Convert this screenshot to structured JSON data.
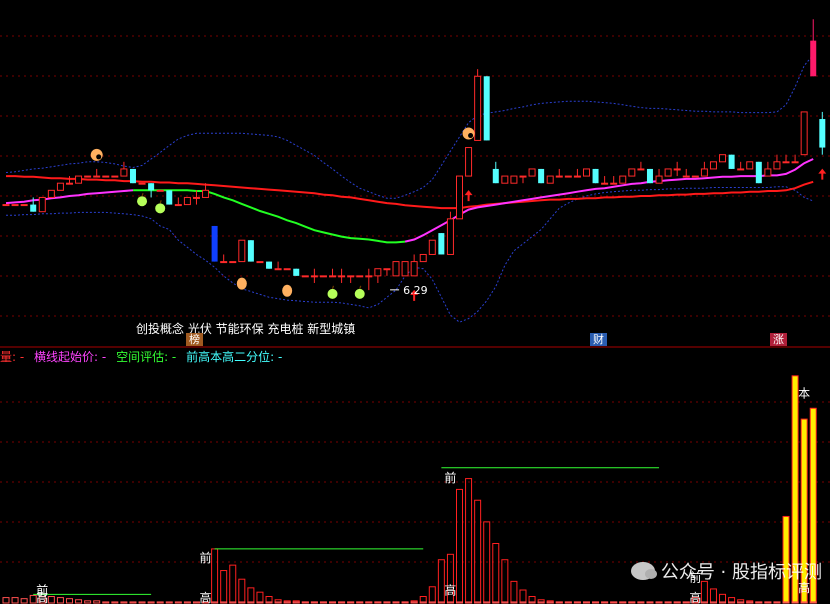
{
  "chart_data": [
    {
      "type": "candlestick",
      "candles": [
        [
          6.6,
          6.6,
          6.6,
          6.6
        ],
        [
          6.6,
          6.6,
          6.6,
          6.6
        ],
        [
          6.6,
          6.6,
          6.6,
          6.6
        ],
        [
          6.6,
          6.5,
          6.7,
          6.5
        ],
        [
          6.5,
          6.7,
          6.7,
          6.5
        ],
        [
          6.7,
          6.8,
          6.8,
          6.7
        ],
        [
          6.8,
          6.9,
          6.9,
          6.8
        ],
        [
          6.9,
          6.9,
          7.0,
          6.9
        ],
        [
          6.9,
          7.0,
          7.0,
          6.9
        ],
        [
          7.0,
          7.0,
          7.0,
          7.0
        ],
        [
          7.0,
          7.0,
          7.1,
          7.0
        ],
        [
          7.0,
          7.0,
          7.0,
          7.0
        ],
        [
          7.0,
          7.0,
          7.0,
          7.0
        ],
        [
          7.0,
          7.1,
          7.2,
          7.0
        ],
        [
          7.1,
          6.9,
          7.1,
          6.9
        ],
        [
          6.9,
          6.9,
          6.9,
          6.9
        ],
        [
          6.9,
          6.8,
          6.9,
          6.7
        ],
        [
          6.8,
          6.8,
          6.8,
          6.8
        ],
        [
          6.8,
          6.6,
          6.8,
          6.6
        ],
        [
          6.6,
          6.6,
          6.7,
          6.6
        ],
        [
          6.6,
          6.7,
          6.7,
          6.6
        ],
        [
          6.7,
          6.7,
          6.8,
          6.6
        ],
        [
          6.7,
          6.8,
          6.9,
          6.7
        ],
        [
          6.3,
          5.8,
          6.3,
          5.8
        ],
        [
          5.8,
          5.8,
          5.9,
          5.8
        ],
        [
          5.8,
          5.8,
          5.8,
          5.8
        ],
        [
          5.8,
          6.1,
          6.1,
          5.8
        ],
        [
          6.1,
          5.8,
          6.1,
          5.8
        ],
        [
          5.8,
          5.8,
          5.8,
          5.8
        ],
        [
          5.8,
          5.7,
          5.8,
          5.7
        ],
        [
          5.7,
          5.7,
          5.8,
          5.7
        ],
        [
          5.7,
          5.7,
          5.7,
          5.7
        ],
        [
          5.7,
          5.6,
          5.7,
          5.6
        ],
        [
          5.6,
          5.6,
          5.6,
          5.6
        ],
        [
          5.6,
          5.6,
          5.7,
          5.5
        ],
        [
          5.6,
          5.6,
          5.6,
          5.6
        ],
        [
          5.6,
          5.6,
          5.7,
          5.6
        ],
        [
          5.6,
          5.6,
          5.7,
          5.5
        ],
        [
          5.6,
          5.6,
          5.6,
          5.5
        ],
        [
          5.6,
          5.6,
          5.6,
          5.6
        ],
        [
          5.6,
          5.6,
          5.7,
          5.4
        ],
        [
          5.6,
          5.7,
          5.7,
          5.5
        ],
        [
          5.7,
          5.7,
          5.7,
          5.6
        ],
        [
          5.6,
          5.8,
          5.8,
          5.6
        ],
        [
          5.6,
          5.8,
          5.8,
          5.6
        ],
        [
          5.6,
          5.8,
          5.9,
          5.6
        ],
        [
          5.8,
          5.9,
          5.9,
          5.8
        ],
        [
          5.9,
          6.1,
          6.1,
          5.9
        ],
        [
          6.2,
          5.9,
          6.2,
          5.9
        ],
        [
          5.9,
          6.4,
          6.5,
          5.9
        ],
        [
          6.4,
          7.0,
          7.0,
          6.4
        ],
        [
          7.0,
          7.4,
          7.4,
          7.0
        ],
        [
          7.5,
          8.4,
          8.5,
          7.5
        ],
        [
          8.4,
          7.5,
          8.4,
          7.5
        ],
        [
          7.1,
          6.9,
          7.2,
          6.9
        ],
        [
          6.9,
          7.0,
          7.0,
          6.9
        ],
        [
          6.9,
          7.0,
          7.0,
          6.9
        ],
        [
          7.0,
          7.0,
          7.0,
          6.9
        ],
        [
          7.0,
          7.1,
          7.1,
          7.0
        ],
        [
          7.1,
          6.9,
          7.1,
          6.9
        ],
        [
          6.9,
          7.0,
          7.0,
          6.9
        ],
        [
          7.0,
          7.0,
          7.1,
          7.0
        ],
        [
          7.0,
          7.0,
          7.0,
          7.0
        ],
        [
          7.0,
          7.0,
          7.1,
          7.0
        ],
        [
          7.0,
          7.1,
          7.1,
          7.0
        ],
        [
          7.1,
          6.9,
          7.1,
          6.9
        ],
        [
          6.9,
          6.9,
          7.0,
          6.9
        ],
        [
          6.9,
          6.9,
          7.0,
          6.9
        ],
        [
          6.9,
          7.0,
          7.0,
          6.9
        ],
        [
          7.0,
          7.1,
          7.1,
          7.0
        ],
        [
          7.1,
          7.1,
          7.2,
          7.1
        ],
        [
          7.1,
          6.9,
          7.1,
          6.9
        ],
        [
          6.9,
          7.0,
          7.1,
          6.9
        ],
        [
          7.0,
          7.1,
          7.1,
          7.0
        ],
        [
          7.1,
          7.1,
          7.2,
          7.0
        ],
        [
          7.0,
          7.0,
          7.1,
          7.0
        ],
        [
          7.0,
          7.0,
          7.0,
          7.0
        ],
        [
          7.0,
          7.1,
          7.2,
          7.0
        ],
        [
          7.1,
          7.2,
          7.2,
          7.1
        ],
        [
          7.2,
          7.3,
          7.3,
          7.2
        ],
        [
          7.3,
          7.1,
          7.3,
          7.1
        ],
        [
          7.1,
          7.1,
          7.2,
          7.1
        ],
        [
          7.1,
          7.2,
          7.2,
          7.1
        ],
        [
          7.2,
          6.9,
          7.2,
          6.9
        ],
        [
          7.0,
          7.1,
          7.2,
          7.0
        ],
        [
          7.1,
          7.2,
          7.3,
          7.1
        ],
        [
          7.2,
          7.2,
          7.3,
          7.2
        ],
        [
          7.2,
          7.2,
          7.3,
          7.2
        ],
        [
          7.3,
          7.9,
          7.9,
          7.3
        ],
        [
          8.9,
          8.4,
          9.2,
          8.4
        ],
        [
          7.8,
          7.4,
          7.9,
          7.3
        ]
      ],
      "up_color": "#ff2a2a",
      "down_color": "#54ffff",
      "ma_long": [
        7.0,
        7.0,
        6.99,
        6.99,
        6.98,
        6.97,
        6.97,
        6.96,
        6.96,
        6.95,
        6.95,
        6.94,
        6.94,
        6.93,
        6.93,
        6.92,
        6.92,
        6.91,
        6.91,
        6.9,
        6.9,
        6.89,
        6.88,
        6.87,
        6.86,
        6.85,
        6.84,
        6.83,
        6.82,
        6.81,
        6.8,
        6.79,
        6.78,
        6.77,
        6.76,
        6.74,
        6.73,
        6.71,
        6.7,
        6.68,
        6.66,
        6.64,
        6.62,
        6.61,
        6.59,
        6.58,
        6.57,
        6.56,
        6.55,
        6.55,
        6.55,
        6.57,
        6.58,
        6.6,
        6.61,
        6.62,
        6.63,
        6.64,
        6.65,
        6.66,
        6.67,
        6.67,
        6.68,
        6.68,
        6.69,
        6.69,
        6.7,
        6.7,
        6.71,
        6.71,
        6.72,
        6.72,
        6.73,
        6.73,
        6.74,
        6.74,
        6.75,
        6.75,
        6.76,
        6.76,
        6.77,
        6.77,
        6.78,
        6.78,
        6.79,
        6.79,
        6.8,
        6.83,
        6.88,
        6.92
      ],
      "ma_mid": [
        6.62,
        6.63,
        6.64,
        6.66,
        6.67,
        6.69,
        6.7,
        6.72,
        6.73,
        6.75,
        6.76,
        6.77,
        6.78,
        6.79,
        6.8,
        6.8,
        6.8,
        6.8,
        6.8,
        6.8,
        6.8,
        6.79,
        6.79,
        6.75,
        6.7,
        6.66,
        6.61,
        6.56,
        6.51,
        6.47,
        6.43,
        6.38,
        6.34,
        6.29,
        6.24,
        6.21,
        6.18,
        6.15,
        6.13,
        6.12,
        6.11,
        6.09,
        6.07,
        6.07,
        6.08,
        6.11,
        6.17,
        6.24,
        6.31,
        6.38,
        6.46,
        6.53,
        6.56,
        6.58,
        6.6,
        6.62,
        6.64,
        6.66,
        6.68,
        6.7,
        6.72,
        6.74,
        6.76,
        6.78,
        6.8,
        6.82,
        6.83,
        6.85,
        6.87,
        6.89,
        6.9,
        6.92,
        6.93,
        6.94,
        6.95,
        6.96,
        6.96,
        6.97,
        6.98,
        6.99,
        6.99,
        7.0,
        7.0,
        7.0,
        7.01,
        7.01,
        7.03,
        7.09,
        7.18,
        7.24
      ],
      "green_segment": [
        14,
        44
      ],
      "band_upper": [
        7.05,
        7.06,
        7.08,
        7.1,
        7.11,
        7.13,
        7.15,
        7.17,
        7.18,
        7.2,
        7.2,
        7.19,
        7.17,
        7.14,
        7.12,
        7.15,
        7.24,
        7.33,
        7.43,
        7.52,
        7.57,
        7.6,
        7.6,
        7.6,
        7.6,
        7.6,
        7.6,
        7.59,
        7.58,
        7.57,
        7.55,
        7.5,
        7.43,
        7.36,
        7.29,
        7.19,
        7.1,
        7.0,
        6.91,
        6.83,
        6.78,
        6.73,
        6.69,
        6.69,
        6.73,
        6.78,
        6.84,
        6.95,
        7.15,
        7.35,
        7.55,
        7.75,
        7.85,
        7.88,
        7.9,
        7.92,
        7.95,
        7.97,
        8.0,
        8.02,
        8.03,
        8.04,
        8.05,
        8.05,
        8.05,
        8.04,
        8.03,
        8.02,
        8.0,
        7.98,
        7.96,
        7.95,
        7.95,
        7.94,
        7.93,
        7.92,
        7.91,
        7.91,
        7.9,
        7.9,
        7.9,
        7.89,
        7.89,
        7.89,
        7.89,
        7.9,
        8.0,
        8.25,
        8.55,
        8.7
      ],
      "band_lower": [
        6.45,
        6.45,
        6.46,
        6.46,
        6.47,
        6.47,
        6.48,
        6.48,
        6.49,
        6.49,
        6.49,
        6.49,
        6.48,
        6.47,
        6.46,
        6.44,
        6.4,
        6.3,
        6.25,
        6.1,
        6.0,
        5.9,
        5.82,
        5.72,
        5.6,
        5.5,
        5.42,
        5.38,
        5.34,
        5.3,
        5.28,
        5.26,
        5.25,
        5.24,
        5.23,
        5.23,
        5.23,
        5.22,
        5.2,
        5.18,
        5.15,
        5.2,
        5.3,
        5.4,
        5.6,
        5.72,
        5.7,
        5.55,
        5.3,
        5.05,
        4.95,
        5.0,
        5.1,
        5.25,
        5.45,
        5.75,
        5.95,
        6.05,
        6.15,
        6.25,
        6.4,
        6.55,
        6.62,
        6.68,
        6.72,
        6.75,
        6.77,
        6.78,
        6.79,
        6.8,
        6.8,
        6.81,
        6.81,
        6.82,
        6.82,
        6.83,
        6.83,
        6.83,
        6.84,
        6.84,
        6.84,
        6.84,
        6.84,
        6.84,
        6.84,
        6.85,
        6.85,
        6.8,
        6.7,
        6.65
      ],
      "ylim": [
        4.7,
        9.4
      ],
      "annotations": {
        "low_price_text": "6.29",
        "low_index": 44,
        "up_arrows": [
          45,
          51,
          90
        ],
        "blue_bar_index": 23,
        "apples": [
          15,
          17,
          36,
          39
        ],
        "hands": [
          26,
          31
        ],
        "peaks": [
          10,
          51
        ]
      }
    },
    {
      "type": "bar",
      "series": [
        {
          "values": [
            5,
            5,
            4,
            7,
            6,
            6,
            5,
            4,
            3,
            2,
            2,
            1,
            1,
            1,
            1,
            1,
            1,
            1,
            1,
            1,
            1,
            1,
            1,
            1,
            1,
            1,
            1,
            1,
            1,
            1,
            1,
            1,
            1,
            1,
            1,
            1,
            1,
            1,
            1,
            1,
            1,
            1,
            1,
            1,
            1,
            1,
            1,
            1,
            1,
            1,
            1,
            1,
            1,
            1,
            1,
            1,
            1,
            1,
            1,
            1,
            1,
            1,
            1,
            1,
            1,
            1,
            1,
            1,
            1,
            1,
            1,
            1,
            1,
            1,
            1,
            1,
            1,
            1,
            1,
            1,
            1,
            1,
            1,
            1,
            1,
            1,
            1,
            1,
            1,
            1
          ]
        },
        {
          "values": [
            0,
            0,
            0,
            0,
            0,
            0,
            0,
            0,
            0,
            0,
            0,
            0,
            0,
            0,
            0,
            0,
            0,
            0,
            0,
            0,
            0,
            0,
            0,
            50,
            30,
            35,
            22,
            14,
            10,
            6,
            3,
            2,
            2,
            1,
            1,
            1,
            1,
            1,
            1,
            1,
            1,
            1,
            1,
            1,
            1,
            2,
            6,
            15,
            40,
            45,
            105,
            115,
            95,
            75,
            55,
            40,
            20,
            12,
            6,
            3,
            2,
            1,
            1,
            1,
            1,
            1,
            1,
            1,
            1,
            1,
            1,
            1,
            1,
            1,
            1,
            1,
            5,
            20,
            13,
            8,
            5,
            3,
            2,
            1,
            1,
            1,
            2,
            75,
            210,
            196
          ]
        },
        {
          "values": [
            0,
            0,
            0,
            0,
            0,
            0,
            0,
            0,
            0,
            0,
            0,
            0,
            0,
            0,
            0,
            0,
            0,
            0,
            0,
            0,
            0,
            0,
            0,
            0,
            0,
            0,
            0,
            0,
            0,
            0,
            0,
            0,
            0,
            0,
            0,
            0,
            0,
            0,
            0,
            0,
            0,
            0,
            0,
            0,
            0,
            0,
            0,
            0,
            0,
            0,
            0,
            0,
            0,
            0,
            0,
            0,
            0,
            0,
            0,
            0,
            0,
            0,
            0,
            0,
            0,
            0,
            0,
            0,
            0,
            0,
            0,
            0,
            0,
            0,
            0,
            0,
            0,
            0,
            0,
            0,
            0,
            0,
            0,
            0,
            0,
            0,
            80,
            210,
            170,
            180
          ]
        }
      ],
      "ylim": [
        0,
        220
      ],
      "labels": {
        "prev": "前",
        "high": "高",
        "ben": "本"
      }
    }
  ],
  "concepts_text": "创投概念 光伏 节能环保 充电桩 新型城镇",
  "tags": {
    "bang": "榜",
    "cai": "财",
    "zhang": "涨"
  },
  "legend": {
    "item1": "量: -",
    "item2": "横线起始价: -",
    "item3": "空间评估: -",
    "item4": "前高本高二分位: -"
  },
  "legend_colors": {
    "item1": "#ff3030",
    "item2": "#ff44ff",
    "item3": "#33ff33",
    "item4": "#44ffff"
  },
  "watermark": "公众号 · 股指标评测"
}
